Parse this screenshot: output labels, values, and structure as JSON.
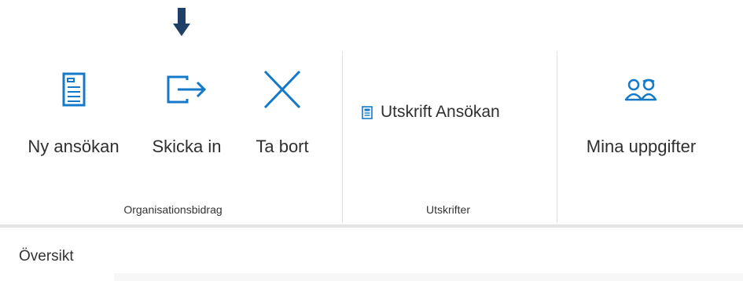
{
  "ribbon": {
    "buttons": [
      {
        "label": "Ny ansökan",
        "icon": "document-icon"
      },
      {
        "label": "Skicka in",
        "icon": "send-icon"
      },
      {
        "label": "Ta bort",
        "icon": "close-icon"
      },
      {
        "label": "Mina uppgifter",
        "icon": "people-icon"
      }
    ],
    "print": {
      "label": "Utskrift Ansökan",
      "icon": "document-small-icon"
    },
    "groups": [
      "Organisationsbidrag",
      "Utskrifter"
    ]
  },
  "tabs": [
    {
      "label": "Översikt"
    }
  ],
  "colors": {
    "accent": "#1479c8",
    "annotation_arrow": "#1f3f66"
  }
}
